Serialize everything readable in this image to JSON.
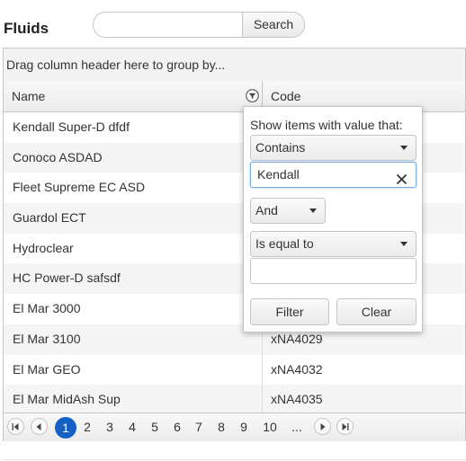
{
  "page": {
    "title": "Fluids"
  },
  "search": {
    "placeholder": "",
    "value": "",
    "button_label": "Search"
  },
  "grid": {
    "group_panel_text": "Drag column header here to group by...",
    "columns": [
      {
        "label": "Name"
      },
      {
        "label": "Code"
      }
    ],
    "rows": [
      {
        "name": "Kendall Super-D dfdf",
        "code": ""
      },
      {
        "name": "Conoco ASDAD",
        "code": ""
      },
      {
        "name": "Fleet Supreme EC ASD",
        "code": ""
      },
      {
        "name": "Guardol ECT",
        "code": ""
      },
      {
        "name": "Hydroclear",
        "code": ""
      },
      {
        "name": "HC Power-D safsdf",
        "code": ""
      },
      {
        "name": "El Mar 3000",
        "code": ""
      },
      {
        "name": "El Mar 3100",
        "code": "xNA4029"
      },
      {
        "name": "El Mar GEO",
        "code": "xNA4032"
      },
      {
        "name": "El Mar MidAsh Sup",
        "code": "xNA4035"
      }
    ]
  },
  "pager": {
    "current_page": "1",
    "pages": [
      "1",
      "2",
      "3",
      "4",
      "5",
      "6",
      "7",
      "8",
      "9",
      "10",
      "..."
    ]
  },
  "filter_popup": {
    "label": "Show items with value that:",
    "operator1": "Contains",
    "value1": "Kendall",
    "logic": "And",
    "operator2": "Is equal to",
    "value2": "",
    "filter_button": "Filter",
    "clear_button": "Clear"
  },
  "colors": {
    "accent": "#1560c4",
    "border": "#c5c5c5",
    "alt_row": "#f5f5f5"
  },
  "icons": [
    "filter-icon",
    "first-page-icon",
    "prev-page-icon",
    "next-page-icon",
    "last-page-icon",
    "clear-text-icon",
    "dropdown-arrow-icon"
  ]
}
